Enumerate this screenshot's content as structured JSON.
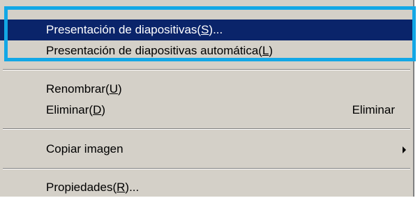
{
  "menu": {
    "items": [
      {
        "label": "Presentación de diapositivas(",
        "accel": "S",
        "suffix": ")...",
        "selected": true
      },
      {
        "label": "Presentación de diapositivas automática(",
        "accel": "L",
        "suffix": ")"
      },
      {
        "label": "Renombrar(",
        "accel": "U",
        "suffix": ")"
      },
      {
        "label": "Eliminar(",
        "accel": "D",
        "suffix": ")",
        "shortcut": "Eliminar"
      },
      {
        "label": "Copiar imagen",
        "accel": "",
        "suffix": "",
        "has_submenu": true
      },
      {
        "label": "Propiedades(",
        "accel": "R",
        "suffix": ")..."
      }
    ]
  },
  "colors": {
    "menu_background": "#d4d0c8",
    "selection_background": "#0a246a",
    "highlight_frame": "#12a7e6"
  },
  "icons": {
    "submenu": "submenu-arrow-icon"
  }
}
